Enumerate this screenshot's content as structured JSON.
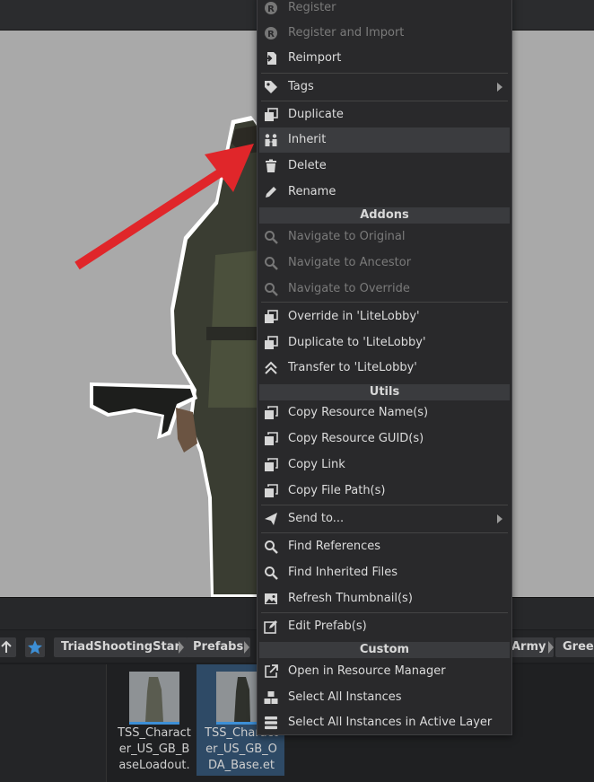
{
  "breadcrumb": {
    "items": [
      "TriadShootingStar",
      "Prefabs",
      "Army",
      "Green"
    ]
  },
  "files": [
    {
      "name": "TSS_Charact er_US_GB_B aseLoadout.",
      "selected": false
    },
    {
      "name": "TSS_Charact er_US_GB_O DA_Base.et",
      "selected": true
    }
  ],
  "menu": {
    "items": [
      {
        "id": "register",
        "label": "Register",
        "icon": "r-circle-icon",
        "disabled": true
      },
      {
        "id": "register-import",
        "label": "Register and Import",
        "icon": "r-circle-icon",
        "disabled": true
      },
      {
        "id": "reimport",
        "label": "Reimport",
        "icon": "reimport-icon"
      },
      {
        "id": "tags",
        "label": "Tags",
        "icon": "tag-icon",
        "submenu": true
      },
      {
        "id": "duplicate",
        "label": "Duplicate",
        "icon": "duplicate-icon"
      },
      {
        "id": "inherit",
        "label": "Inherit",
        "icon": "inherit-icon",
        "hover": true
      },
      {
        "id": "delete",
        "label": "Delete",
        "icon": "trash-icon"
      },
      {
        "id": "rename",
        "label": "Rename",
        "icon": "pencil-icon"
      },
      {
        "id": "nav-original",
        "label": "Navigate to Original",
        "icon": "search-icon",
        "disabled": true
      },
      {
        "id": "nav-ancestor",
        "label": "Navigate to Ancestor",
        "icon": "search-icon",
        "disabled": true
      },
      {
        "id": "nav-override",
        "label": "Navigate to Override",
        "icon": "search-icon",
        "disabled": true
      },
      {
        "id": "override-in",
        "label": "Override in 'LiteLobby'",
        "icon": "duplicate-icon"
      },
      {
        "id": "duplicate-to",
        "label": "Duplicate to 'LiteLobby'",
        "icon": "duplicate-icon"
      },
      {
        "id": "transfer-to",
        "label": "Transfer to 'LiteLobby'",
        "icon": "double-chevron-up-icon"
      },
      {
        "id": "copy-name",
        "label": "Copy Resource Name(s)",
        "icon": "copy-icon"
      },
      {
        "id": "copy-guid",
        "label": "Copy Resource GUID(s)",
        "icon": "copy-icon"
      },
      {
        "id": "copy-link",
        "label": "Copy Link",
        "icon": "copy-icon"
      },
      {
        "id": "copy-path",
        "label": "Copy File Path(s)",
        "icon": "copy-icon"
      },
      {
        "id": "send-to",
        "label": "Send to...",
        "icon": "send-icon",
        "submenu": true
      },
      {
        "id": "find-refs",
        "label": "Find References",
        "icon": "search-icon"
      },
      {
        "id": "find-inherited",
        "label": "Find Inherited Files",
        "icon": "search-icon"
      },
      {
        "id": "refresh-thumb",
        "label": "Refresh Thumbnail(s)",
        "icon": "image-icon"
      },
      {
        "id": "edit-prefab",
        "label": "Edit Prefab(s)",
        "icon": "edit-icon"
      },
      {
        "id": "open-rm",
        "label": "Open in Resource Manager",
        "icon": "external-link-icon"
      },
      {
        "id": "select-all",
        "label": "Select All Instances",
        "icon": "cubes-icon"
      },
      {
        "id": "select-active",
        "label": "Select All Instances in Active Layer",
        "icon": "layers-icon"
      }
    ],
    "headers": [
      "Addons",
      "Utils",
      "Custom"
    ]
  },
  "colors": {
    "accent_arrow": "#e0262a",
    "menu_bg": "#29292b",
    "selection": "#2e4a66"
  }
}
